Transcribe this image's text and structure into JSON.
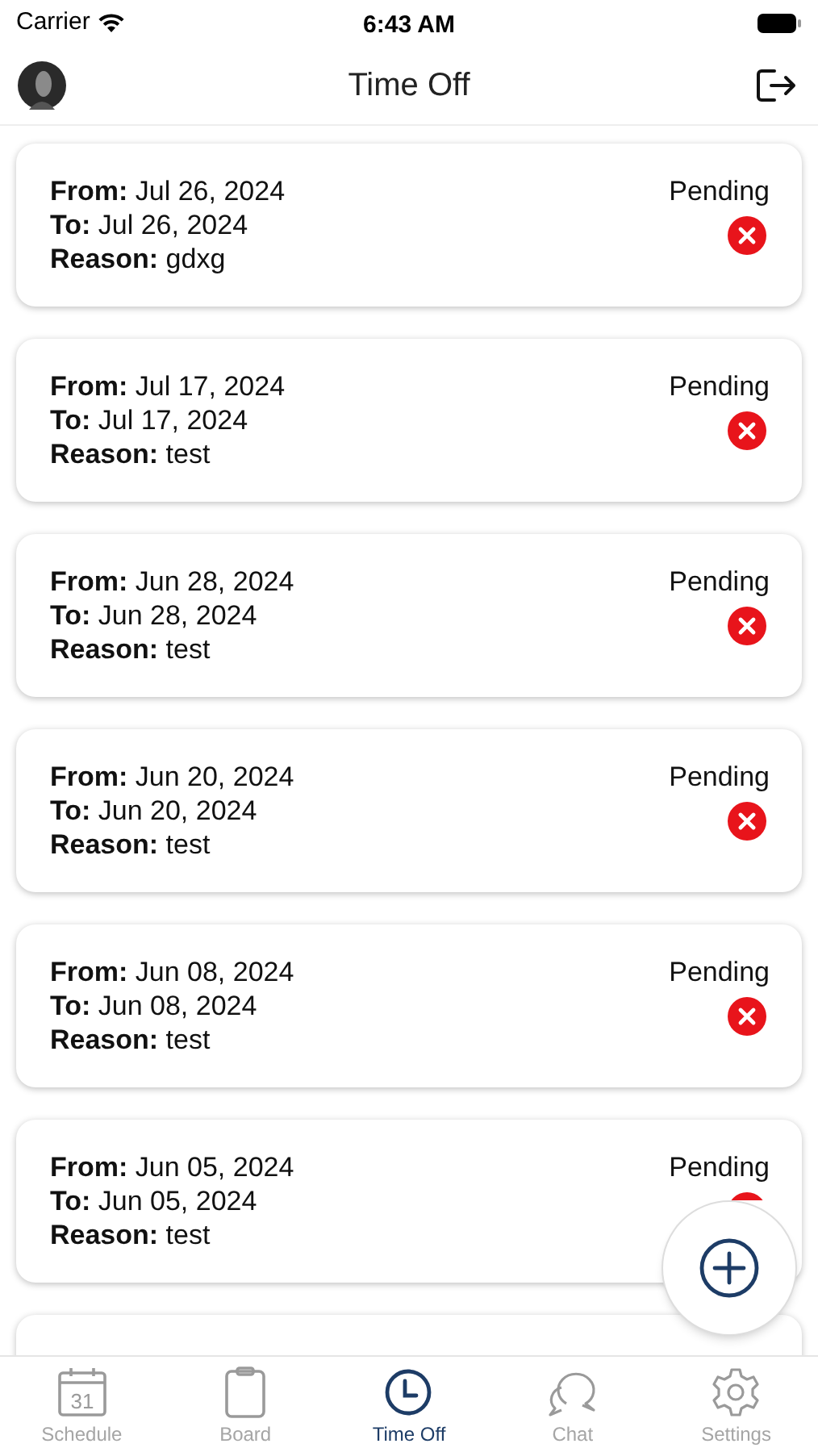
{
  "status_bar": {
    "carrier": "Carrier",
    "time": "6:43 AM"
  },
  "header": {
    "title": "Time Off"
  },
  "requests": [
    {
      "from_label": "From:",
      "from": "Jul 26, 2024",
      "to_label": "To:",
      "to": "Jul 26, 2024",
      "reason_label": "Reason:",
      "reason": "gdxg",
      "status": "Pending"
    },
    {
      "from_label": "From:",
      "from": "Jul 17, 2024",
      "to_label": "To:",
      "to": "Jul 17, 2024",
      "reason_label": "Reason:",
      "reason": "test",
      "status": "Pending"
    },
    {
      "from_label": "From:",
      "from": "Jun 28, 2024",
      "to_label": "To:",
      "to": "Jun 28, 2024",
      "reason_label": "Reason:",
      "reason": "test",
      "status": "Pending"
    },
    {
      "from_label": "From:",
      "from": "Jun 20, 2024",
      "to_label": "To:",
      "to": "Jun 20, 2024",
      "reason_label": "Reason:",
      "reason": "test",
      "status": "Pending"
    },
    {
      "from_label": "From:",
      "from": "Jun 08, 2024",
      "to_label": "To:",
      "to": "Jun 08, 2024",
      "reason_label": "Reason:",
      "reason": "test",
      "status": "Pending"
    },
    {
      "from_label": "From:",
      "from": "Jun 05, 2024",
      "to_label": "To:",
      "to": "Jun 05, 2024",
      "reason_label": "Reason:",
      "reason": "test",
      "status": "Pending"
    }
  ],
  "tabs": [
    {
      "kind": "calendar",
      "label": "Schedule",
      "icon_text": "31",
      "selected": false
    },
    {
      "kind": "clipboard",
      "label": "Board",
      "selected": false
    },
    {
      "kind": "clock",
      "label": "Time Off",
      "selected": true
    },
    {
      "kind": "chat",
      "label": "Chat",
      "selected": false
    },
    {
      "kind": "gear",
      "label": "Settings",
      "selected": false
    }
  ]
}
